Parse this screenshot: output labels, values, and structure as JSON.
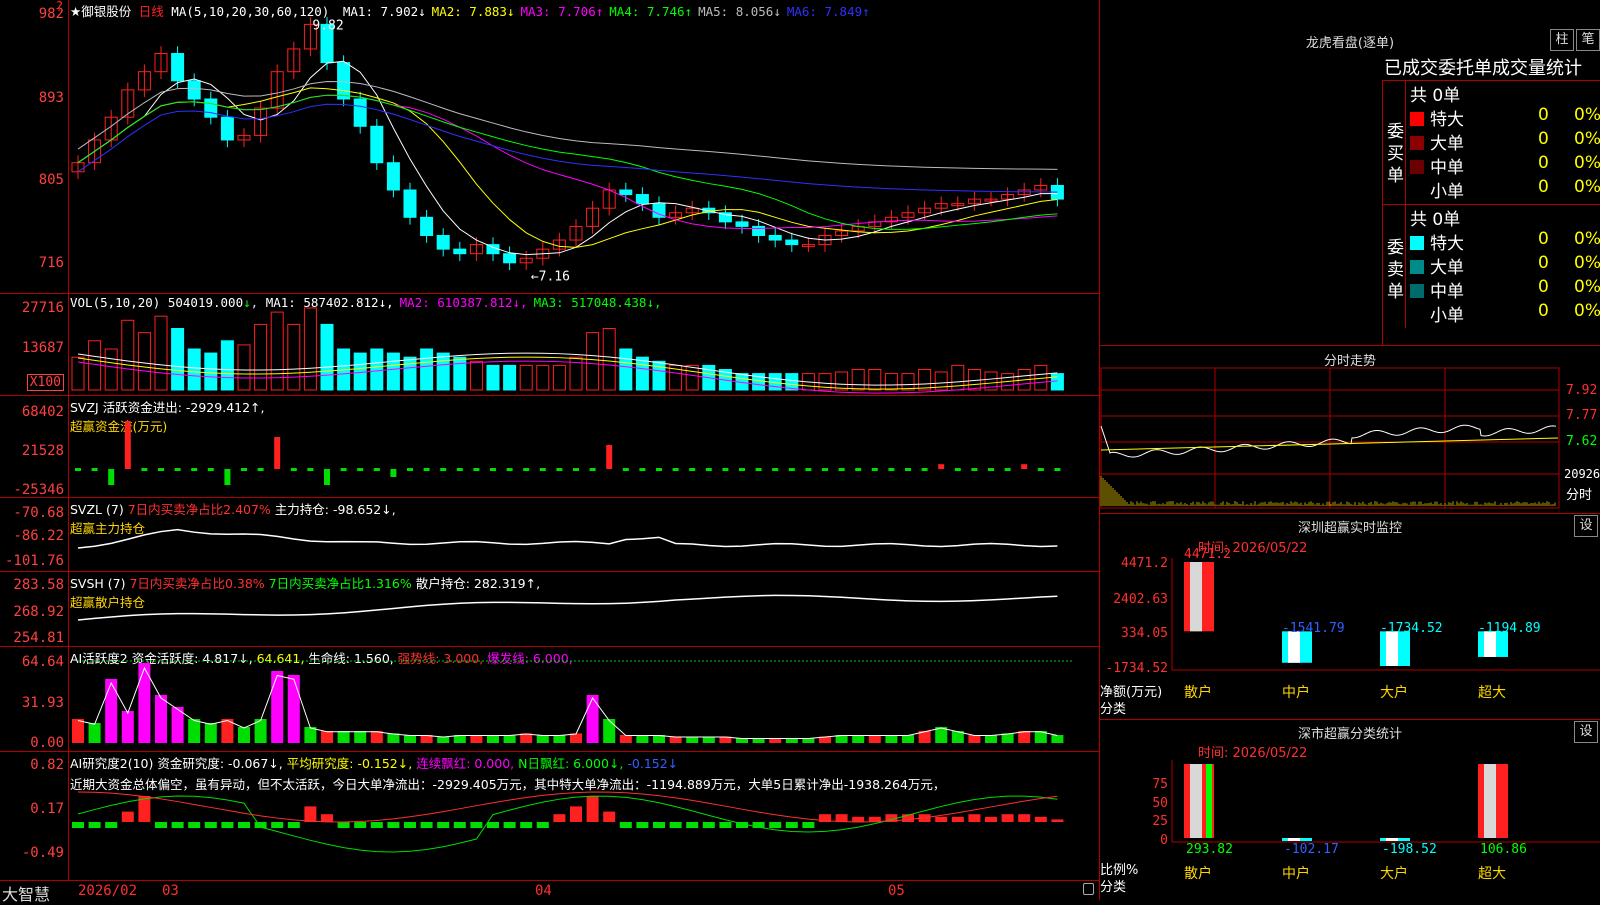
{
  "colors": {
    "up": "#ff2020",
    "down": "#00ffff",
    "ma1": "#ffffff",
    "ma2": "#ffff00",
    "ma3": "#ff00ff",
    "ma4": "#00ff00",
    "ma5": "#bbbbbb",
    "ma6": "#3030ff",
    "grid": "#b00000"
  },
  "corner_mark": "?",
  "kline": {
    "stock_name": "★御银股份",
    "period": "日线",
    "ma_label": "MA(5,10,20,30,60,120)",
    "ma_values": [
      {
        "name": "MA1:",
        "value": "7.902",
        "arrow": "↓",
        "color": "#ffffff"
      },
      {
        "name": "MA2:",
        "value": "7.883",
        "arrow": "↓",
        "color": "#ffff00"
      },
      {
        "name": "MA3:",
        "value": "7.706",
        "arrow": "↑",
        "color": "#ff00ff"
      },
      {
        "name": "MA4:",
        "value": "7.746",
        "arrow": "↑",
        "color": "#00ff00"
      },
      {
        "name": "MA5:",
        "value": "8.056",
        "arrow": "↓",
        "color": "#bbbbbb"
      },
      {
        "name": "MA6:",
        "value": "7.849",
        "arrow": "↑",
        "color": "#3030ff"
      }
    ],
    "y_ticks": [
      "982",
      "893",
      "805",
      "716"
    ],
    "high_label": "9.82",
    "low_label": "←7.16"
  },
  "vol": {
    "label": "VOL(5,10,20)",
    "value": "504019.000",
    "arrow": "↓",
    "mas": [
      {
        "text": "MA1: 587402.812↓",
        "color": "#ffffff"
      },
      {
        "text": "MA2: 610387.812↓",
        "color": "#ff00ff"
      },
      {
        "text": "MA3: 517048.438↓",
        "color": "#00ff00"
      }
    ],
    "y_ticks": [
      "27716",
      "13687"
    ],
    "unit": "X100"
  },
  "svzj": {
    "line1": "SVZJ  活跃资金进出: -2929.412↑,",
    "line2": "超赢资金流(万元)",
    "y_ticks": [
      "68402",
      "21528",
      "-25346"
    ]
  },
  "svzl": {
    "name": "SVZL (7)",
    "a": "7日内买卖净占比2.407%",
    "b": "主力持仓: -98.652↓,",
    "line2": "超赢主力持仓",
    "y_ticks": [
      "-70.68",
      "-86.22",
      "-101.76"
    ]
  },
  "svsh": {
    "name": "SVSH (7)",
    "a": "7日内买卖净占比0.38%",
    "b": "7日内买卖净占比1.316%",
    "c": "散户持仓: 282.319↑,",
    "line2": "超赢散户持仓",
    "y_ticks": [
      "283.58",
      "268.92",
      "254.81"
    ]
  },
  "ai1": {
    "name": "AI活跃度2",
    "a": "资金活跃度: 4.817↓,",
    "b": "64.641,",
    "c": "生命线: 1.560,",
    "d": "强势线: 3.000,",
    "e": "爆发线: 6.000,",
    "y_ticks": [
      "64.64",
      "31.93",
      "0.00"
    ]
  },
  "ai2": {
    "name": "AI研究度2(10)",
    "a": "资金研究度: -0.067↓,",
    "b": "平均研究度: -0.152↓,",
    "c": "连续飘红: 0.000,",
    "d": "N日飘红: 6.000↓,",
    "e": "-0.152↓",
    "comment": "近期大资金总体偏空，虽有异动，但不太活跃，今日大单净流出：-2929.405万元，其中特大单净流出：-1194.889万元，大单5日累计净出-1938.264万元，",
    "y_ticks": [
      "0.82",
      "0.17",
      "-0.49"
    ]
  },
  "bottom": {
    "logo": "大智慧",
    "dates": [
      "2026/02",
      "03",
      "04",
      "05"
    ]
  },
  "dragon": {
    "title": "龙虎看盘(逐单)",
    "btn1": "柱",
    "btn2": "笔",
    "subtitle": "已成交委托单成交量统计",
    "buy_label": "委买单",
    "sell_label": "委卖单",
    "buy_total": "共 0单",
    "sell_total": "共 0单",
    "buy_rows": [
      {
        "label": "特大",
        "n": "0",
        "p": "0%",
        "color": "#ff0000"
      },
      {
        "label": "大单",
        "n": "0",
        "p": "0%",
        "color": "#8b0000"
      },
      {
        "label": "中单",
        "n": "0",
        "p": "0%",
        "color": "#6b0000"
      },
      {
        "label": "小单",
        "n": "0",
        "p": "0%",
        "color": ""
      }
    ],
    "sell_rows": [
      {
        "label": "特大",
        "n": "0",
        "p": "0%",
        "color": "#00ffff"
      },
      {
        "label": "大单",
        "n": "0",
        "p": "0%",
        "color": "#008b8b"
      },
      {
        "label": "中单",
        "n": "0",
        "p": "0%",
        "color": "#006b6b"
      },
      {
        "label": "小单",
        "n": "0",
        "p": "0%",
        "color": ""
      }
    ]
  },
  "intraday": {
    "title": "分时走势",
    "y_ticks": [
      "7.92",
      "7.77",
      "7.62"
    ],
    "vol_label": "20926",
    "vol_unit": "分时"
  },
  "monitor": {
    "title": "深圳超赢实时监控",
    "btn": "设",
    "time": "时间: 2026/05/22",
    "y_ticks": [
      "4471.2",
      "2402.63",
      "334.05",
      "-1734.52"
    ],
    "ylabel": "净额(万元)",
    "xlabel": "分类",
    "categories": [
      "散户",
      "中户",
      "大户",
      "超大"
    ],
    "values": [
      4471.2,
      -1541.79,
      -1734.52,
      -1194.89
    ],
    "value_labels": [
      "4471.2",
      "-1541.79",
      "-1734.52",
      "-1194.89"
    ]
  },
  "classify": {
    "title": "深市超赢分类统计",
    "btn": "设",
    "time": "时间: 2026/05/22",
    "y_ticks": [
      "75",
      "50",
      "25",
      "0"
    ],
    "ylabel": "比例%",
    "xlabel": "分类",
    "categories": [
      "散户",
      "中户",
      "大户",
      "超大"
    ],
    "values": [
      293.82,
      -102.17,
      -198.52,
      106.86
    ],
    "value_labels": [
      "293.82",
      "-102.17",
      "-198.52",
      "106.86"
    ]
  }
}
